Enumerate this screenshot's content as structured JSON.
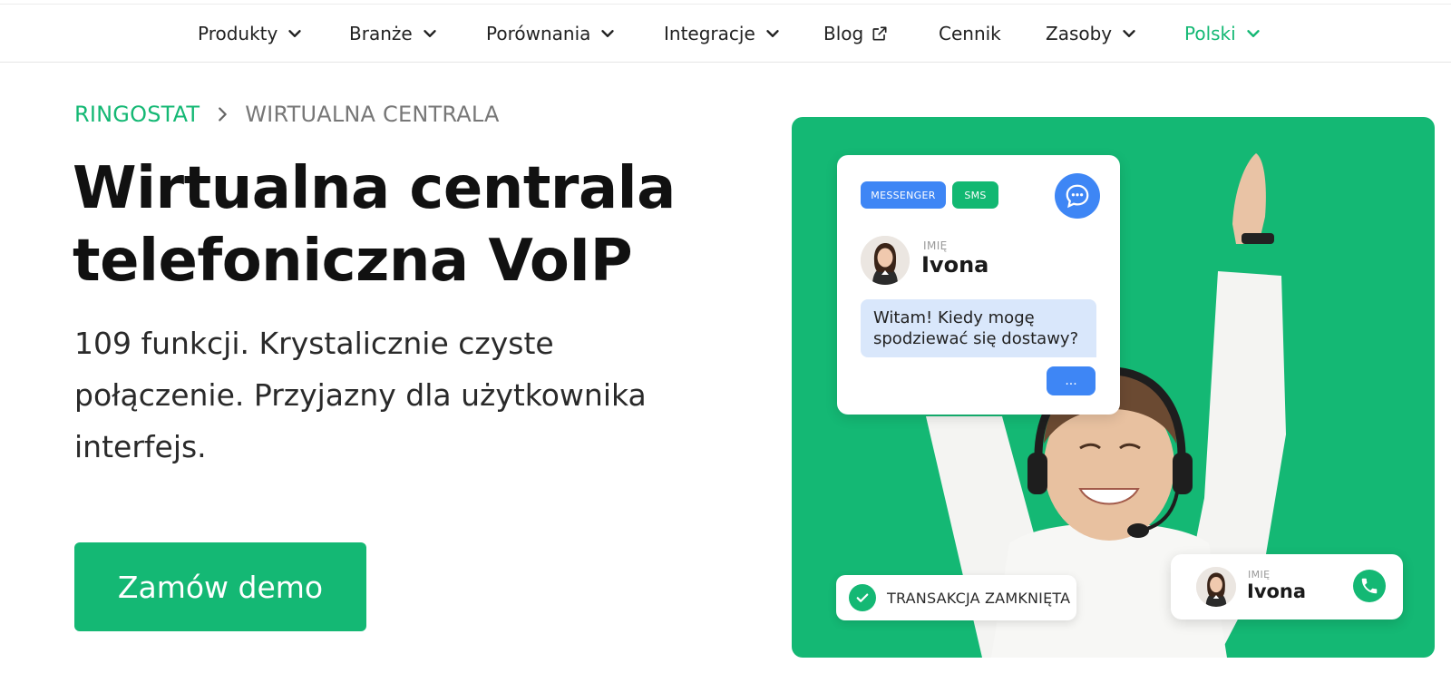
{
  "nav": {
    "items": [
      {
        "label": "Produkty",
        "icon": "chevron-down-icon"
      },
      {
        "label": "Branże",
        "icon": "chevron-down-icon"
      },
      {
        "label": "Porównania",
        "icon": "chevron-down-icon"
      },
      {
        "label": "Integracje",
        "icon": "chevron-down-icon"
      },
      {
        "label": "Blog",
        "icon": "external-link-icon"
      },
      {
        "label": "Cennik"
      },
      {
        "label": "Zasoby",
        "icon": "chevron-down-icon"
      }
    ],
    "language": {
      "label": "Polski",
      "icon": "chevron-down-icon"
    }
  },
  "breadcrumb": {
    "home": "RINGOSTAT",
    "current": "WIRTUALNA CENTRALA"
  },
  "hero": {
    "title_line1": "Wirtualna centrala",
    "title_line2": "telefoniczna VoIP",
    "subtitle_line1": "109 funkcji. Krystalicznie czyste",
    "subtitle_line2": "połączenie. Przyjazny dla użytkownika",
    "subtitle_line3": "interfejs.",
    "cta_label": "Zamów demo"
  },
  "visual": {
    "chat_card": {
      "badge_messenger": "MESSENGER",
      "badge_sms": "SMS",
      "name_label": "IMIĘ",
      "name_value": "Ivona",
      "message_line1": "Witam! Kiedy mogę",
      "message_line2": "spodziewać się dostawy?",
      "typing": "..."
    },
    "status": {
      "text": "TRANSAKCJA ZAMKNIĘTA"
    },
    "call_card": {
      "name_label": "IMIĘ",
      "name_value": "Ivona"
    }
  },
  "colors": {
    "brand_green": "#14b874",
    "accent_blue": "#3e86f5",
    "bubble_blue": "#d9e7fb"
  }
}
